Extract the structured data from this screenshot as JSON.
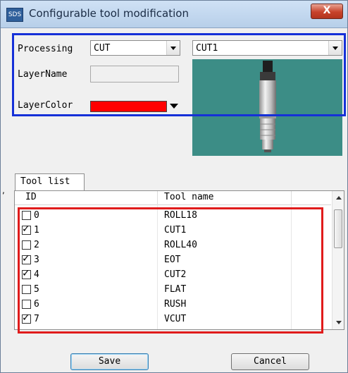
{
  "window": {
    "title": "Configurable tool modification",
    "app_icon_text": "SDS",
    "close_glyph": "X"
  },
  "processing": {
    "label": "Processing",
    "value": "CUT",
    "tool_value": "CUT1"
  },
  "layer": {
    "name_label": "LayerName",
    "name_value": "",
    "color_label": "LayerColor",
    "color": "#ff0000"
  },
  "tool_list": {
    "tab_label": "Tool list",
    "columns": [
      "ID",
      "Tool name"
    ],
    "rows": [
      {
        "id": "0",
        "name": "ROLL18",
        "checked": false
      },
      {
        "id": "1",
        "name": "CUT1",
        "checked": true
      },
      {
        "id": "2",
        "name": "ROLL40",
        "checked": false
      },
      {
        "id": "3",
        "name": "EOT",
        "checked": true
      },
      {
        "id": "4",
        "name": "CUT2",
        "checked": true
      },
      {
        "id": "5",
        "name": "FLAT",
        "checked": false
      },
      {
        "id": "6",
        "name": "RUSH",
        "checked": false
      },
      {
        "id": "7",
        "name": "VCUT",
        "checked": true
      }
    ]
  },
  "buttons": {
    "save": "Save",
    "cancel": "Cancel"
  },
  "side_mark": ",",
  "colors": {
    "highlight_blue": "#1530d8",
    "highlight_red": "#e01b1b",
    "preview_bg": "#3c8d86"
  }
}
